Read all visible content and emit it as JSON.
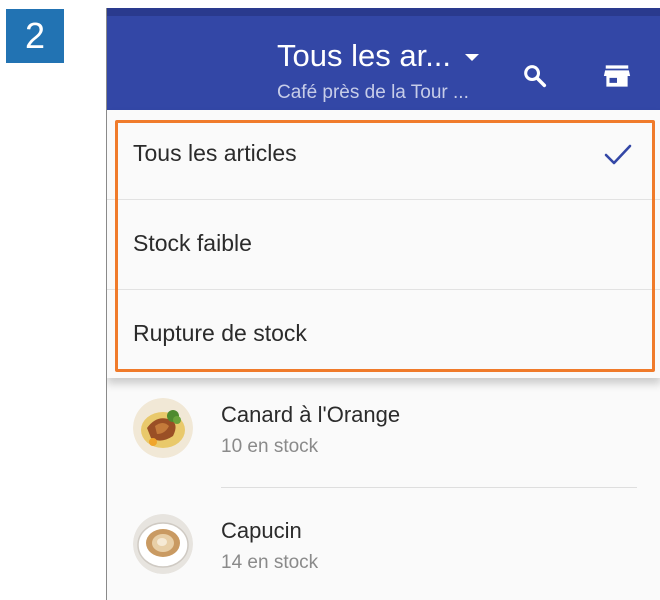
{
  "step": {
    "number": "2"
  },
  "app_bar": {
    "title": "Tous les ar...",
    "subtitle": "Café près de la Tour ..."
  },
  "icons": {
    "dropdown": "caret-down-icon",
    "search": "search-icon",
    "store": "store-icon",
    "selected": "checkmark-icon"
  },
  "colors": {
    "app_bar": "#3347a6",
    "step_badge": "#2273b3",
    "highlight": "#f07b2b",
    "check": "#3347a6"
  },
  "dropdown": {
    "items": [
      {
        "label": "Tous les articles",
        "selected": true
      },
      {
        "label": "Stock faible",
        "selected": false
      },
      {
        "label": "Rupture de stock",
        "selected": false
      }
    ]
  },
  "items": [
    {
      "name": "Canard à l'Orange",
      "stock": "10 en stock"
    },
    {
      "name": "Capucin",
      "stock": "14 en stock"
    }
  ]
}
